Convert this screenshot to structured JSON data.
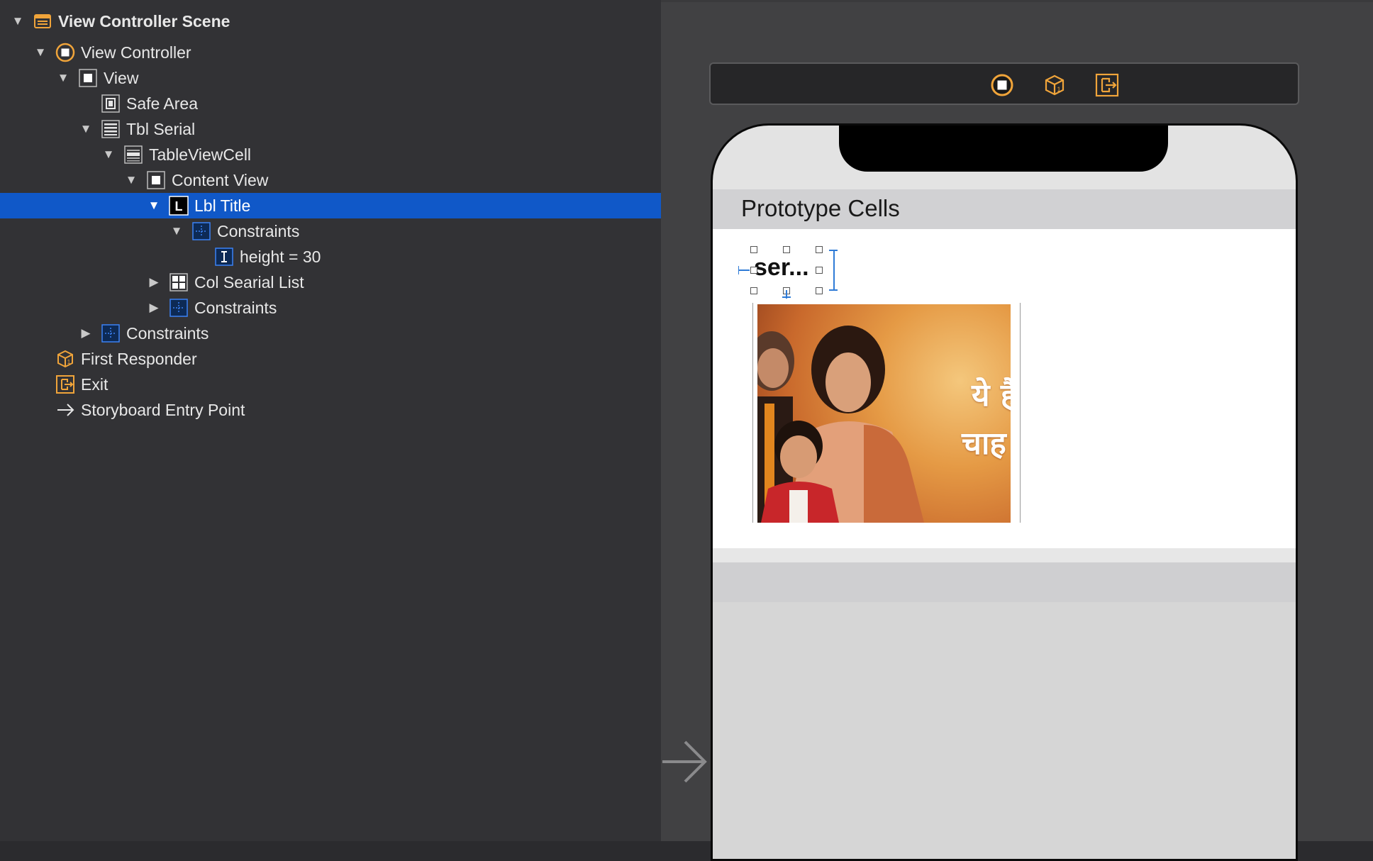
{
  "outline": {
    "rows": [
      {
        "label": "View Controller Scene",
        "icon": "scene-icon",
        "disclosure": "expanded"
      },
      {
        "label": "View Controller",
        "icon": "view-controller-icon",
        "disclosure": "expanded"
      },
      {
        "label": "View",
        "icon": "view-icon",
        "disclosure": "expanded"
      },
      {
        "label": "Safe Area",
        "icon": "safe-area-icon",
        "disclosure": "none"
      },
      {
        "label": "Tbl Serial",
        "icon": "table-view-icon",
        "disclosure": "expanded"
      },
      {
        "label": "TableViewCell",
        "icon": "table-cell-icon",
        "disclosure": "expanded"
      },
      {
        "label": "Content View",
        "icon": "view-icon",
        "disclosure": "expanded"
      },
      {
        "label": "Lbl Title",
        "icon": "label-icon",
        "disclosure": "expanded",
        "selected": true
      },
      {
        "label": "Constraints",
        "icon": "constraints-icon",
        "disclosure": "expanded"
      },
      {
        "label": "height = 30",
        "icon": "height-constraint-icon",
        "disclosure": "none"
      },
      {
        "label": "Col Searial List",
        "icon": "collection-view-icon",
        "disclosure": "collapsed"
      },
      {
        "label": "Constraints",
        "icon": "constraints-icon",
        "disclosure": "collapsed"
      },
      {
        "label": "Constraints",
        "icon": "constraints-icon",
        "disclosure": "collapsed"
      },
      {
        "label": "First Responder",
        "icon": "first-responder-icon",
        "disclosure": "none"
      },
      {
        "label": "Exit",
        "icon": "exit-icon",
        "disclosure": "none"
      },
      {
        "label": "Storyboard Entry Point",
        "icon": "entry-arrow-icon",
        "disclosure": "none"
      }
    ]
  },
  "canvas": {
    "dock_icons": [
      "view-controller-icon",
      "first-responder-icon",
      "exit-icon"
    ],
    "section_header": "Prototype Cells",
    "label_text": "ser...",
    "poster_text_line1": "ये है",
    "poster_text_line2": "चाह"
  },
  "colors": {
    "selection": "#1058c8",
    "accent_orange": "#f0a43a",
    "constraint_blue": "#3b82f6"
  }
}
